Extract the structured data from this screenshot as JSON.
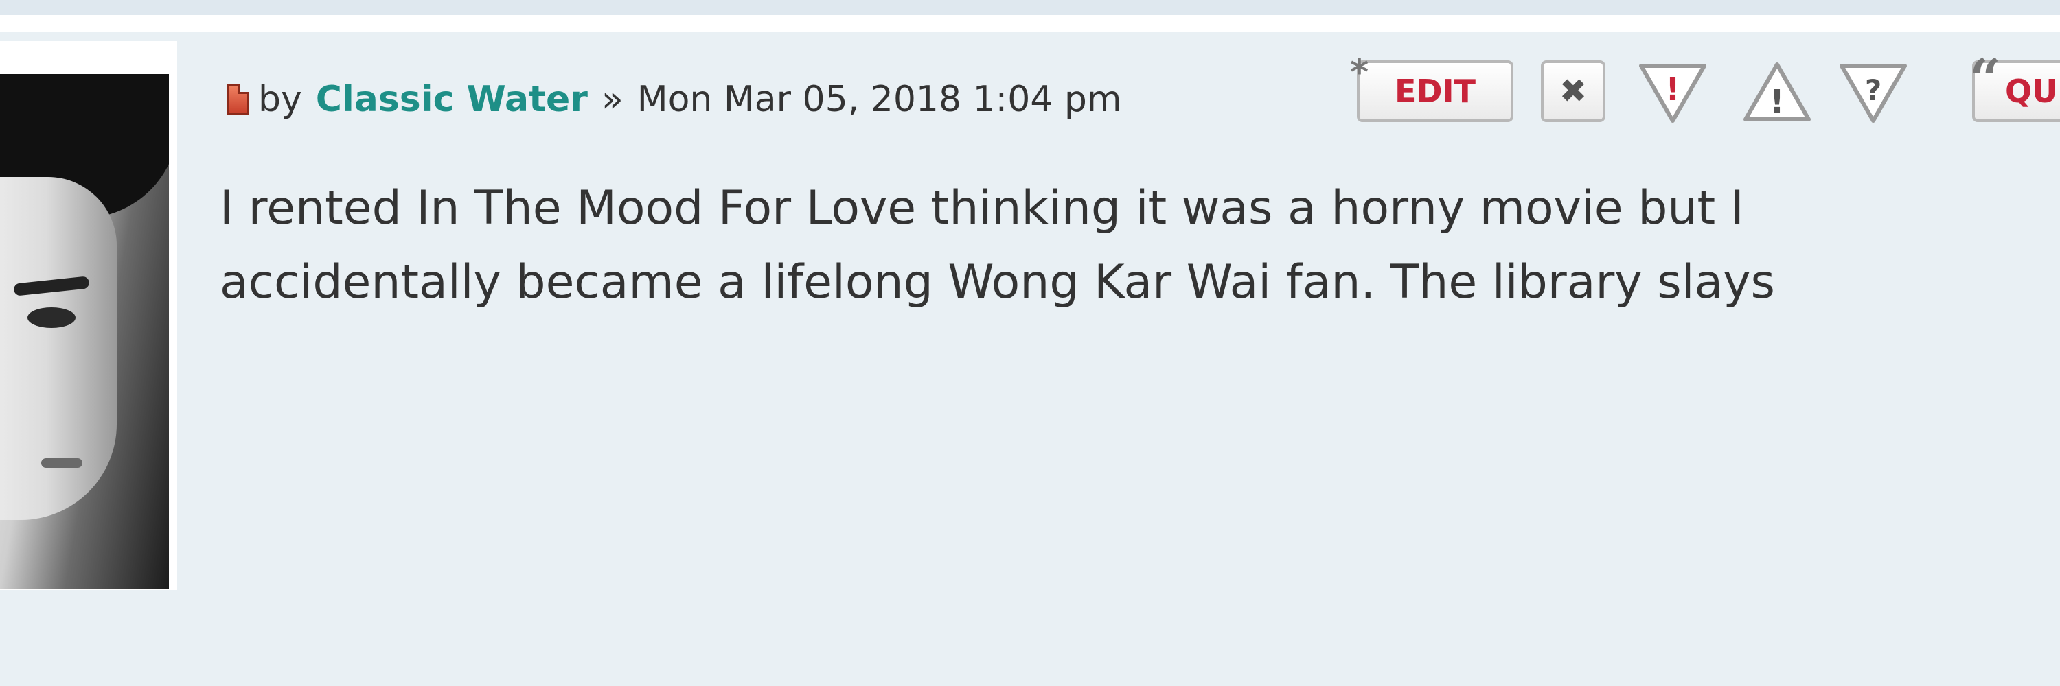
{
  "post": {
    "by_label": "by",
    "author": "Classic Water",
    "separator": "»",
    "timestamp": "Mon Mar 05, 2018 1:04 pm",
    "body_line1": "I rented In The Mood For Love thinking it was a horny movie but I",
    "body_line2": "accidentally became a lifelong Wong Kar Wai fan. The library slays"
  },
  "actions": {
    "edit_label": "EDIT",
    "delete_symbol": "✖",
    "report_symbol": "!",
    "warn_symbol": "!",
    "info_symbol": "?",
    "quote_label": "QU"
  },
  "colors": {
    "author": "#1e8f87",
    "action_red": "#c8243a",
    "background": "#e9f0f4"
  },
  "icons": {
    "post": "post-icon",
    "edit": "edit-icon",
    "delete": "delete-icon",
    "report": "report-icon",
    "warn": "warning-icon",
    "info": "info-icon",
    "quote": "quote-icon"
  }
}
